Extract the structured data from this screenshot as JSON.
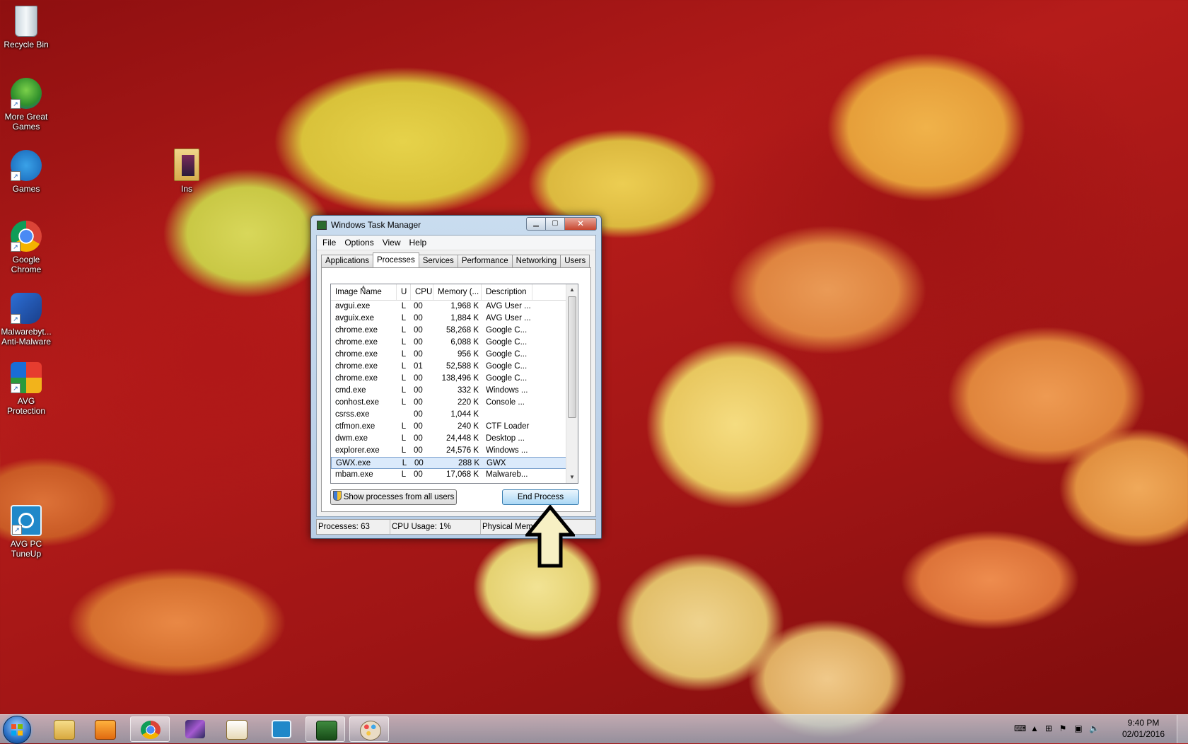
{
  "desktop": {
    "icons": [
      {
        "label": "Recycle Bin"
      },
      {
        "label": "More Great Games"
      },
      {
        "label": "Games"
      },
      {
        "label": "Google Chrome"
      },
      {
        "label": "Malwarebyt... Anti-Malware"
      },
      {
        "label": "AVG Protection"
      },
      {
        "label": "AVG PC TuneUp"
      },
      {
        "label": "Ins"
      }
    ]
  },
  "window": {
    "title": "Windows Task Manager",
    "min_glyph": "▁",
    "max_glyph": "▢",
    "close_glyph": "✕"
  },
  "menu": [
    "File",
    "Options",
    "View",
    "Help"
  ],
  "tabs": [
    "Applications",
    "Processes",
    "Services",
    "Performance",
    "Networking",
    "Users"
  ],
  "active_tab": "Processes",
  "columns": [
    "Image Name",
    "U",
    "CPU",
    "Memory (...",
    "Description"
  ],
  "processes": [
    {
      "name": "avgui.exe",
      "user": "L",
      "cpu": "00",
      "mem": "1,968 K",
      "desc": "AVG User ..."
    },
    {
      "name": "avguix.exe",
      "user": "L",
      "cpu": "00",
      "mem": "1,884 K",
      "desc": "AVG User ..."
    },
    {
      "name": "chrome.exe",
      "user": "L",
      "cpu": "00",
      "mem": "58,268 K",
      "desc": "Google C..."
    },
    {
      "name": "chrome.exe",
      "user": "L",
      "cpu": "00",
      "mem": "6,088 K",
      "desc": "Google C..."
    },
    {
      "name": "chrome.exe",
      "user": "L",
      "cpu": "00",
      "mem": "956 K",
      "desc": "Google C..."
    },
    {
      "name": "chrome.exe",
      "user": "L",
      "cpu": "01",
      "mem": "52,588 K",
      "desc": "Google C..."
    },
    {
      "name": "chrome.exe",
      "user": "L",
      "cpu": "00",
      "mem": "138,496 K",
      "desc": "Google C..."
    },
    {
      "name": "cmd.exe",
      "user": "L",
      "cpu": "00",
      "mem": "332 K",
      "desc": "Windows ..."
    },
    {
      "name": "conhost.exe",
      "user": "L",
      "cpu": "00",
      "mem": "220 K",
      "desc": "Console ..."
    },
    {
      "name": "csrss.exe",
      "user": "",
      "cpu": "00",
      "mem": "1,044 K",
      "desc": ""
    },
    {
      "name": "ctfmon.exe",
      "user": "L",
      "cpu": "00",
      "mem": "240 K",
      "desc": "CTF Loader"
    },
    {
      "name": "dwm.exe",
      "user": "L",
      "cpu": "00",
      "mem": "24,448 K",
      "desc": "Desktop ..."
    },
    {
      "name": "explorer.exe",
      "user": "L",
      "cpu": "00",
      "mem": "24,576 K",
      "desc": "Windows ..."
    },
    {
      "name": "GWX.exe",
      "user": "L",
      "cpu": "00",
      "mem": "288 K",
      "desc": "GWX",
      "selected": true
    },
    {
      "name": "mbam.exe",
      "user": "L",
      "cpu": "00",
      "mem": "17,068 K",
      "desc": "Malwareb..."
    }
  ],
  "buttons": {
    "show_all": "Show processes from all users",
    "end_process": "End Process"
  },
  "status": {
    "processes": "Processes: 63",
    "cpu": "CPU Usage: 1%",
    "memory": "Physical Memory: ...%"
  },
  "taskbar": {
    "time": "9:40 PM",
    "date": "02/01/2016"
  },
  "colors": {
    "selection": "#dbeafb",
    "arrow_fill": "#f7f0c4"
  }
}
